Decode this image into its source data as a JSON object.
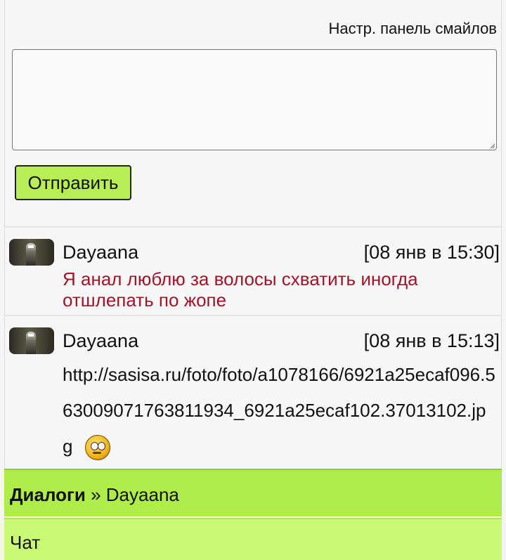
{
  "compose": {
    "smiley_panel_link": "Настр. панель смайлов",
    "message_value": "",
    "send_label": "Отправить"
  },
  "messages": [
    {
      "author": "Dayaana",
      "time": "[08 янв в 15:30]",
      "text": "Я анал люблю за волосы схватить иногда отшлепать по жопе",
      "text_color": "#a0142a"
    },
    {
      "author": "Dayaana",
      "time": "[08 янв в 15:13]",
      "text": "http://sasisa.ru/foto/foto/a1078166/6921a25ecaf096.56300907176381193­4_6921a25ecaf102.37013102.jpg",
      "emoji": "rolling-eyes-emoji-icon"
    }
  ],
  "breadcrumb": {
    "root": "Диалоги",
    "separator": "»",
    "current": "Dayaana"
  },
  "chat_link": "Чат",
  "colors": {
    "accent_green": "#aeed4a",
    "light_green": "#c9fa74",
    "message_red": "#a0142a"
  }
}
